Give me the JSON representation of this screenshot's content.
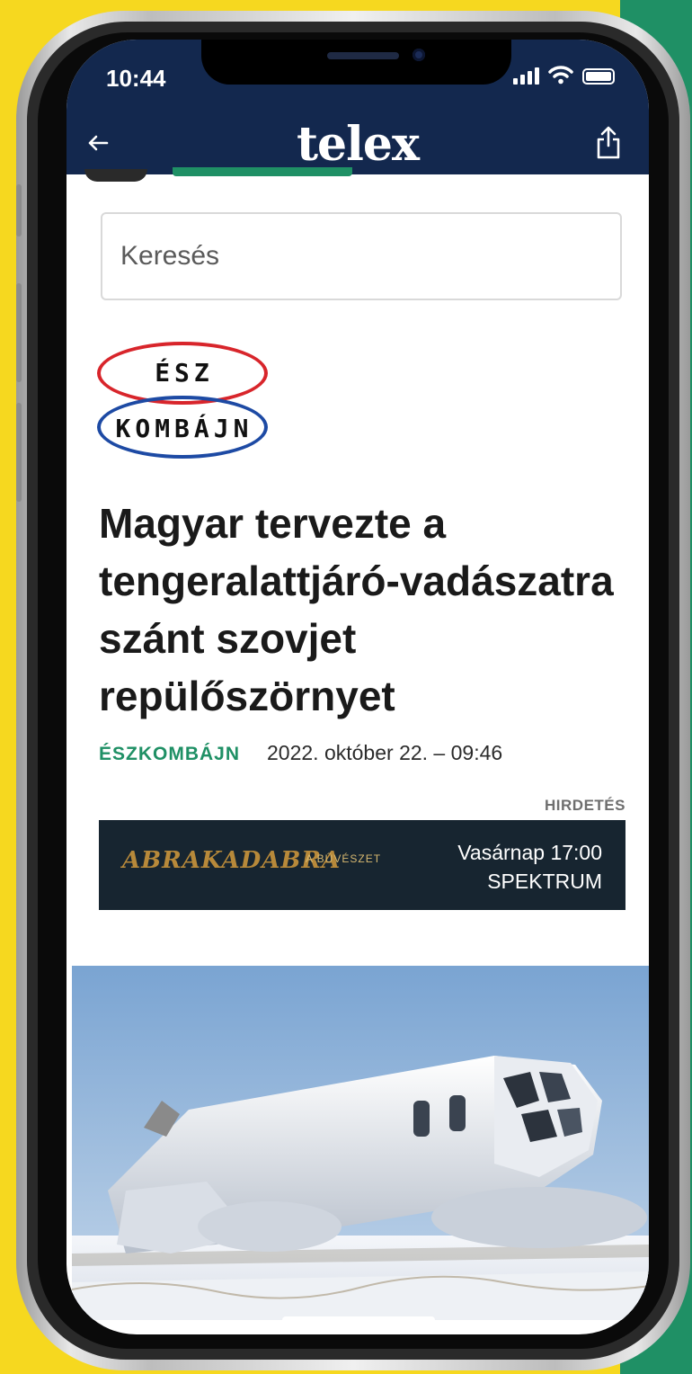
{
  "status_bar": {
    "time": "10:44"
  },
  "header": {
    "logo": "telex"
  },
  "search": {
    "placeholder": "Keresés"
  },
  "column_logo": {
    "line1": "ÉSZ",
    "line2": "KOMBÁJN"
  },
  "article": {
    "title": "Magyar tervezte a tengeralattjáró-vadászatra szánt szovjet repülőszörnyet",
    "column_tag": "ÉSZKOMBÁJN",
    "date": "2022. október 22. – 09:46"
  },
  "ad": {
    "label": "HIRDETÉS",
    "brand": "ABRAKADABRA",
    "subtitle": "A BŰVÉSZET",
    "schedule": "Vasárnap 17:00",
    "venue": "SPEKTRUM"
  },
  "colors": {
    "header_bg": "#13284e",
    "accent_green": "#1f9065",
    "background_yellow": "#f6d81f"
  },
  "icons": [
    "back-arrow-icon",
    "share-icon",
    "signal-icon",
    "wifi-icon",
    "battery-icon"
  ]
}
